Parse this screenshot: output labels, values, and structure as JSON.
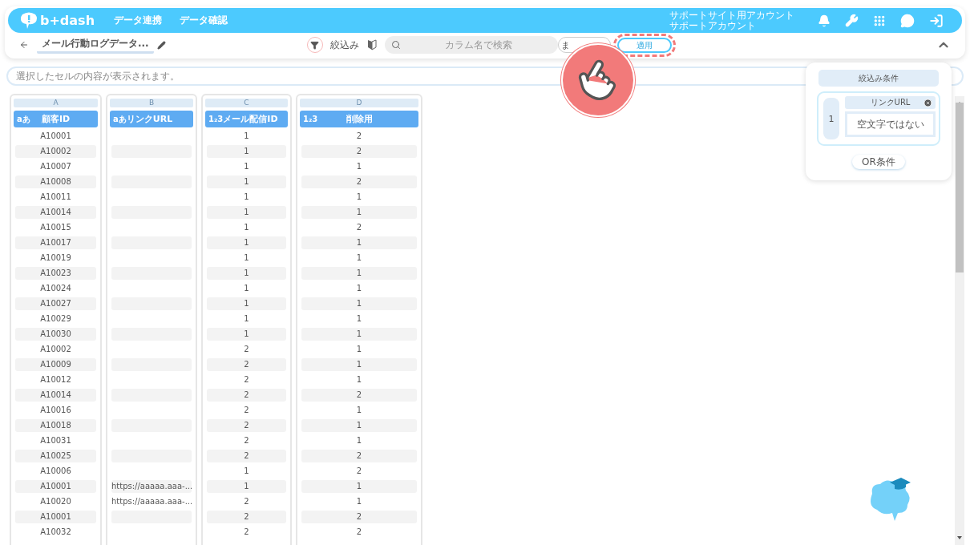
{
  "header": {
    "logo": "b+dash",
    "nav": [
      {
        "label": "データ連携"
      },
      {
        "label": "データ確認"
      }
    ],
    "account": [
      "サポートサイト用アカウント",
      "サポートアカウント"
    ]
  },
  "toolbar": {
    "title": "メール行動ログデータ...",
    "filter_label": "絞込み",
    "search": {
      "placeholder": "カラム名で検索"
    },
    "partial_button": "ま",
    "apply_button": "適用",
    "apply_highlighted": true
  },
  "cell_preview": {
    "placeholder": "選択したセルの内容が表示されます。"
  },
  "columns": [
    {
      "letter": "A",
      "type_icon": "aあ",
      "name": "顧客ID"
    },
    {
      "letter": "B",
      "type_icon": "aあ",
      "name": "リンクURL"
    },
    {
      "letter": "C",
      "type_icon": "1₂3",
      "name": "メール配信ID"
    },
    {
      "letter": "D",
      "type_icon": "1₂3",
      "name": "削除用"
    }
  ],
  "rows": [
    [
      "A10001",
      null,
      "1",
      "2"
    ],
    [
      "A10002",
      null,
      "1",
      "2"
    ],
    [
      "A10007",
      null,
      "1",
      "1"
    ],
    [
      "A10008",
      null,
      "1",
      "2"
    ],
    [
      "A10011",
      null,
      "1",
      "1"
    ],
    [
      "A10014",
      null,
      "1",
      "1"
    ],
    [
      "A10015",
      null,
      "1",
      "2"
    ],
    [
      "A10017",
      null,
      "1",
      "1"
    ],
    [
      "A10019",
      null,
      "1",
      "1"
    ],
    [
      "A10023",
      null,
      "1",
      "1"
    ],
    [
      "A10024",
      null,
      "1",
      "1"
    ],
    [
      "A10027",
      null,
      "1",
      "1"
    ],
    [
      "A10029",
      null,
      "1",
      "1"
    ],
    [
      "A10030",
      null,
      "1",
      "1"
    ],
    [
      "A10002",
      null,
      "2",
      "1"
    ],
    [
      "A10009",
      null,
      "2",
      "1"
    ],
    [
      "A10012",
      null,
      "2",
      "1"
    ],
    [
      "A10014",
      null,
      "2",
      "2"
    ],
    [
      "A10016",
      null,
      "2",
      "1"
    ],
    [
      "A10018",
      null,
      "2",
      "1"
    ],
    [
      "A10031",
      null,
      "2",
      "1"
    ],
    [
      "A10025",
      null,
      "2",
      "2"
    ],
    [
      "A10006",
      null,
      "1",
      "2"
    ],
    [
      "A10001",
      "https://aaaaa.aaa-...",
      "1",
      "1"
    ],
    [
      "A10020",
      "https://aaaaa.aaa-...",
      "2",
      "1"
    ],
    [
      "A10001",
      null,
      "2",
      "2"
    ],
    [
      "A10032",
      null,
      "2",
      "2"
    ]
  ],
  "filter_panel": {
    "title": "絞込み条件",
    "conditions": [
      {
        "index": "1",
        "column": "リンクURL",
        "rule": "空文字ではない"
      }
    ],
    "or_button": "OR条件"
  }
}
